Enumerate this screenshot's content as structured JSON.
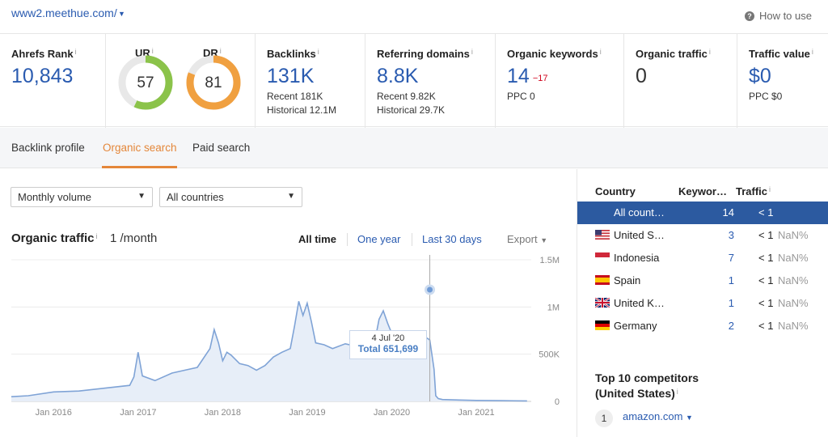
{
  "header": {
    "domain": "www2.meethue.com/",
    "how_to_use": "How to use"
  },
  "metrics": {
    "ahrefs_rank": {
      "label": "Ahrefs Rank",
      "value": "10,843"
    },
    "ur": {
      "label": "UR",
      "value": "57",
      "score": 57,
      "color": "#8bc34a"
    },
    "dr": {
      "label": "DR",
      "value": "81",
      "score": 81,
      "color": "#f0a040"
    },
    "backlinks": {
      "label": "Backlinks",
      "value": "131K",
      "recent": "Recent 181K",
      "historical": "Historical 12.1M"
    },
    "referring_domains": {
      "label": "Referring domains",
      "value": "8.8K",
      "recent": "Recent 9.82K",
      "historical": "Historical 29.7K"
    },
    "organic_keywords": {
      "label": "Organic keywords",
      "value": "14",
      "delta": "−17",
      "ppc": "PPC 0"
    },
    "organic_traffic": {
      "label": "Organic traffic",
      "value": "0"
    },
    "traffic_value": {
      "label": "Traffic value",
      "value": "$0",
      "ppc": "PPC $0"
    }
  },
  "tabs": [
    "Backlink profile",
    "Organic search",
    "Paid search"
  ],
  "filters": {
    "volume": "Monthly volume",
    "countries": "All countries"
  },
  "chart_header": {
    "title": "Organic traffic",
    "value": "1 /month",
    "ranges": [
      "All time",
      "One year",
      "Last 30 days"
    ],
    "export": "Export"
  },
  "tooltip": {
    "date": "4 Jul '20",
    "total": "Total 651,699"
  },
  "chart_data": {
    "type": "area",
    "x_ticks": [
      "Jan 2016",
      "Jan 2017",
      "Jan 2018",
      "Jan 2019",
      "Jan 2020",
      "Jan 2021"
    ],
    "y_ticks": [
      "1.5M",
      "1M",
      "500K",
      "0"
    ],
    "ylim": [
      0,
      1500000
    ],
    "series": [
      {
        "x": [
          2015.5,
          2015.7,
          2016.0,
          2016.3,
          2016.6,
          2016.9,
          2016.95,
          2017.0,
          2017.05,
          2017.2,
          2017.4,
          2017.55,
          2017.7,
          2017.85,
          2017.9,
          2017.95,
          2018.0,
          2018.05,
          2018.1,
          2018.2,
          2018.3,
          2018.4,
          2018.5,
          2018.6,
          2018.7,
          2018.8,
          2018.85,
          2018.9,
          2018.95,
          2019.0,
          2019.05,
          2019.1,
          2019.2,
          2019.3,
          2019.45,
          2019.6,
          2019.7,
          2019.8,
          2019.85,
          2019.9,
          2019.95,
          2020.0,
          2020.1,
          2020.3,
          2020.4,
          2020.45,
          2020.5,
          2020.52,
          2020.55,
          2020.6,
          2020.8,
          2021.0,
          2021.3,
          2021.6
        ],
        "y": [
          50000,
          60000,
          100000,
          110000,
          140000,
          170000,
          260000,
          520000,
          270000,
          220000,
          300000,
          330000,
          360000,
          560000,
          760000,
          620000,
          430000,
          520000,
          490000,
          400000,
          380000,
          330000,
          380000,
          470000,
          520000,
          560000,
          800000,
          1060000,
          910000,
          1040000,
          840000,
          620000,
          600000,
          560000,
          610000,
          580000,
          600000,
          640000,
          870000,
          960000,
          830000,
          720000,
          710000,
          700000,
          680000,
          651699,
          340000,
          60000,
          30000,
          20000,
          15000,
          10000,
          8000,
          5000
        ]
      }
    ]
  },
  "side": {
    "headers": {
      "country": "Country",
      "keywords": "Keywor…",
      "traffic": "Traffic"
    },
    "rows": [
      {
        "name": "All count…",
        "kw": "14",
        "traffic": "< 1",
        "pct": ""
      },
      {
        "name": "United S…",
        "kw": "3",
        "traffic": "< 1",
        "pct": "NaN%"
      },
      {
        "name": "Indonesia",
        "kw": "7",
        "traffic": "< 1",
        "pct": "NaN%"
      },
      {
        "name": "Spain",
        "kw": "1",
        "traffic": "< 1",
        "pct": "NaN%"
      },
      {
        "name": "United K…",
        "kw": "1",
        "traffic": "< 1",
        "pct": "NaN%"
      },
      {
        "name": "Germany",
        "kw": "2",
        "traffic": "< 1",
        "pct": "NaN%"
      }
    ],
    "competitors_title_1": "Top 10 competitors",
    "competitors_title_2": "(United States)",
    "competitor_1_num": "1",
    "competitor_1": "amazon.com"
  }
}
